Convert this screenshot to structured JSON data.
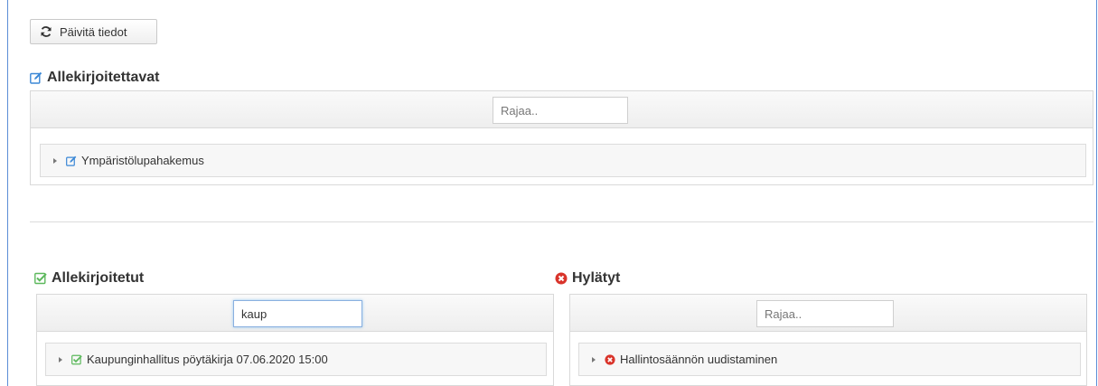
{
  "toolbar": {
    "refresh_label": "Päivitä tiedot",
    "refresh_icon": "refresh-icon"
  },
  "to_sign": {
    "title": "Allekirjoitettavat",
    "title_icon": "edit-icon",
    "filter_placeholder": "Rajaa..",
    "filter_value": "",
    "items": [
      {
        "label": "Ympäristölupahakemus",
        "icon": "edit-icon"
      }
    ]
  },
  "signed": {
    "title": "Allekirjoitetut",
    "title_icon": "check-square-icon",
    "filter_placeholder": "Rajaa..",
    "filter_value": "kaup",
    "items": [
      {
        "label": "Kaupunginhallitus pöytäkirja 07.06.2020 15:00",
        "icon": "check-square-icon"
      }
    ]
  },
  "rejected": {
    "title": "Hylätyt",
    "title_icon": "times-circle-icon",
    "filter_placeholder": "Rajaa..",
    "filter_value": "",
    "items": [
      {
        "label": "Hallintosäännön uudistaminen",
        "icon": "times-circle-icon"
      }
    ]
  },
  "colors": {
    "edit_icon": "#3a87d6",
    "check_icon": "#5cb85c",
    "reject_icon": "#d9342b",
    "frame": "#5b8dd6"
  }
}
